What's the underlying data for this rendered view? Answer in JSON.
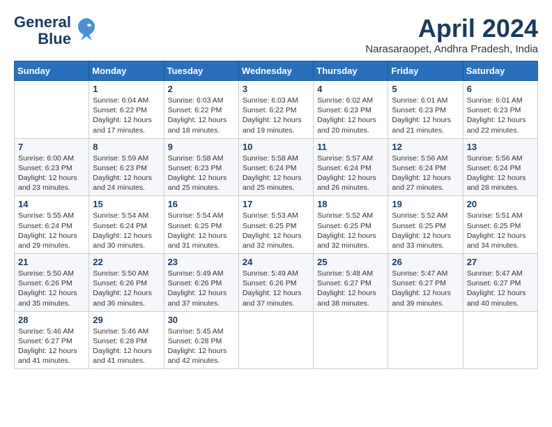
{
  "header": {
    "logo_line1": "General",
    "logo_line2": "Blue",
    "title": "April 2024",
    "subtitle": "Narasaraopet, Andhra Pradesh, India"
  },
  "weekdays": [
    "Sunday",
    "Monday",
    "Tuesday",
    "Wednesday",
    "Thursday",
    "Friday",
    "Saturday"
  ],
  "weeks": [
    [
      {
        "day": "",
        "info": ""
      },
      {
        "day": "1",
        "info": "Sunrise: 6:04 AM\nSunset: 6:22 PM\nDaylight: 12 hours\nand 17 minutes."
      },
      {
        "day": "2",
        "info": "Sunrise: 6:03 AM\nSunset: 6:22 PM\nDaylight: 12 hours\nand 18 minutes."
      },
      {
        "day": "3",
        "info": "Sunrise: 6:03 AM\nSunset: 6:22 PM\nDaylight: 12 hours\nand 19 minutes."
      },
      {
        "day": "4",
        "info": "Sunrise: 6:02 AM\nSunset: 6:23 PM\nDaylight: 12 hours\nand 20 minutes."
      },
      {
        "day": "5",
        "info": "Sunrise: 6:01 AM\nSunset: 6:23 PM\nDaylight: 12 hours\nand 21 minutes."
      },
      {
        "day": "6",
        "info": "Sunrise: 6:01 AM\nSunset: 6:23 PM\nDaylight: 12 hours\nand 22 minutes."
      }
    ],
    [
      {
        "day": "7",
        "info": "Sunrise: 6:00 AM\nSunset: 6:23 PM\nDaylight: 12 hours\nand 23 minutes."
      },
      {
        "day": "8",
        "info": "Sunrise: 5:59 AM\nSunset: 6:23 PM\nDaylight: 12 hours\nand 24 minutes."
      },
      {
        "day": "9",
        "info": "Sunrise: 5:58 AM\nSunset: 6:23 PM\nDaylight: 12 hours\nand 25 minutes."
      },
      {
        "day": "10",
        "info": "Sunrise: 5:58 AM\nSunset: 6:24 PM\nDaylight: 12 hours\nand 25 minutes."
      },
      {
        "day": "11",
        "info": "Sunrise: 5:57 AM\nSunset: 6:24 PM\nDaylight: 12 hours\nand 26 minutes."
      },
      {
        "day": "12",
        "info": "Sunrise: 5:56 AM\nSunset: 6:24 PM\nDaylight: 12 hours\nand 27 minutes."
      },
      {
        "day": "13",
        "info": "Sunrise: 5:56 AM\nSunset: 6:24 PM\nDaylight: 12 hours\nand 28 minutes."
      }
    ],
    [
      {
        "day": "14",
        "info": "Sunrise: 5:55 AM\nSunset: 6:24 PM\nDaylight: 12 hours\nand 29 minutes."
      },
      {
        "day": "15",
        "info": "Sunrise: 5:54 AM\nSunset: 6:24 PM\nDaylight: 12 hours\nand 30 minutes."
      },
      {
        "day": "16",
        "info": "Sunrise: 5:54 AM\nSunset: 6:25 PM\nDaylight: 12 hours\nand 31 minutes."
      },
      {
        "day": "17",
        "info": "Sunrise: 5:53 AM\nSunset: 6:25 PM\nDaylight: 12 hours\nand 32 minutes."
      },
      {
        "day": "18",
        "info": "Sunrise: 5:52 AM\nSunset: 6:25 PM\nDaylight: 12 hours\nand 32 minutes."
      },
      {
        "day": "19",
        "info": "Sunrise: 5:52 AM\nSunset: 6:25 PM\nDaylight: 12 hours\nand 33 minutes."
      },
      {
        "day": "20",
        "info": "Sunrise: 5:51 AM\nSunset: 6:25 PM\nDaylight: 12 hours\nand 34 minutes."
      }
    ],
    [
      {
        "day": "21",
        "info": "Sunrise: 5:50 AM\nSunset: 6:26 PM\nDaylight: 12 hours\nand 35 minutes."
      },
      {
        "day": "22",
        "info": "Sunrise: 5:50 AM\nSunset: 6:26 PM\nDaylight: 12 hours\nand 36 minutes."
      },
      {
        "day": "23",
        "info": "Sunrise: 5:49 AM\nSunset: 6:26 PM\nDaylight: 12 hours\nand 37 minutes."
      },
      {
        "day": "24",
        "info": "Sunrise: 5:49 AM\nSunset: 6:26 PM\nDaylight: 12 hours\nand 37 minutes."
      },
      {
        "day": "25",
        "info": "Sunrise: 5:48 AM\nSunset: 6:27 PM\nDaylight: 12 hours\nand 38 minutes."
      },
      {
        "day": "26",
        "info": "Sunrise: 5:47 AM\nSunset: 6:27 PM\nDaylight: 12 hours\nand 39 minutes."
      },
      {
        "day": "27",
        "info": "Sunrise: 5:47 AM\nSunset: 6:27 PM\nDaylight: 12 hours\nand 40 minutes."
      }
    ],
    [
      {
        "day": "28",
        "info": "Sunrise: 5:46 AM\nSunset: 6:27 PM\nDaylight: 12 hours\nand 41 minutes."
      },
      {
        "day": "29",
        "info": "Sunrise: 5:46 AM\nSunset: 6:28 PM\nDaylight: 12 hours\nand 41 minutes."
      },
      {
        "day": "30",
        "info": "Sunrise: 5:45 AM\nSunset: 6:28 PM\nDaylight: 12 hours\nand 42 minutes."
      },
      {
        "day": "",
        "info": ""
      },
      {
        "day": "",
        "info": ""
      },
      {
        "day": "",
        "info": ""
      },
      {
        "day": "",
        "info": ""
      }
    ]
  ]
}
